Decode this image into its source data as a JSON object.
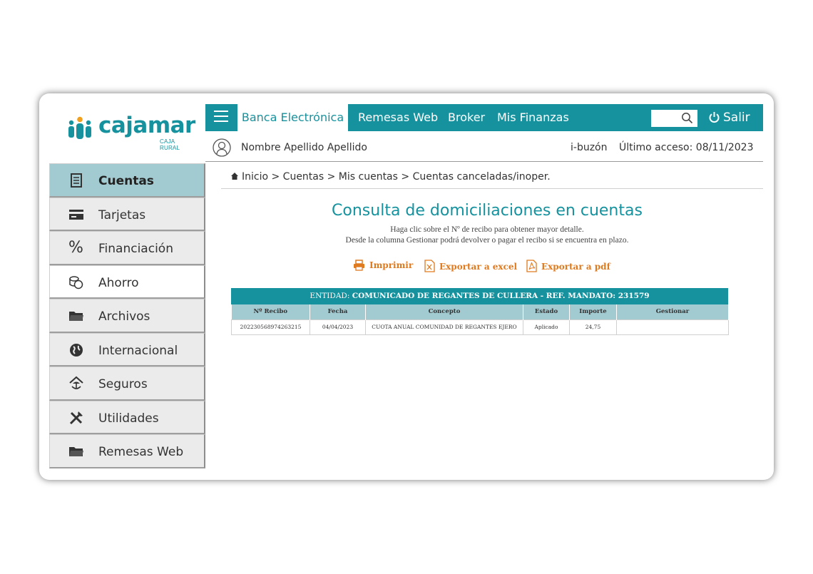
{
  "brand": {
    "name": "cajamar",
    "sub": "CAJA RURAL",
    "color": "#15929e"
  },
  "topnav": {
    "active_tab": "Banca Electrónica",
    "links": [
      "Remesas Web",
      "Broker",
      "Mis Finanzas"
    ],
    "search_placeholder": "",
    "logout_label": "Salir"
  },
  "userbar": {
    "user_name": "Nombre Apellido Apellido",
    "ibuzon": "i-buzón",
    "last_access": "Último acceso: 08/11/2023"
  },
  "sidebar": {
    "items": [
      {
        "label": "Cuentas",
        "icon": "ledger-icon",
        "active": true
      },
      {
        "label": "Tarjetas",
        "icon": "card-icon"
      },
      {
        "label": "Financiación",
        "icon": "percent-icon"
      },
      {
        "label": "Ahorro",
        "icon": "coins-icon"
      },
      {
        "label": "Archivos",
        "icon": "folder-icon"
      },
      {
        "label": "Internacional",
        "icon": "globe-icon"
      },
      {
        "label": "Seguros",
        "icon": "umbrella-house-icon"
      },
      {
        "label": "Utilidades",
        "icon": "tools-icon"
      },
      {
        "label": "Remesas Web",
        "icon": "folder-icon"
      }
    ]
  },
  "breadcrumb": "Inicio > Cuentas > Mis cuentas > Cuentas canceladas/inoper.",
  "page": {
    "title": "Consulta de domiciliaciones en cuentas",
    "help_1": "Haga clic sobre el Nº de recibo para obtener mayor detalle.",
    "help_2": "Desde la columna Gestionar podrá devolver o pagar el recibo si se encuentra en plazo."
  },
  "actions": {
    "print": "Imprimir",
    "excel": "Exportar a excel",
    "pdf": "Exportar a pdf"
  },
  "table": {
    "entity_prefix": "ENTIDAD:",
    "entity": "COMUNICADO DE REGANTES DE CULLERA - REF. MANDATO: 231579",
    "columns": [
      "Nº Recibo",
      "Fecha",
      "Concepto",
      "Estado",
      "Importe",
      "Gestionar"
    ],
    "rows": [
      {
        "recibo": "202230568974263215",
        "fecha": "04/04/2023",
        "concepto": "CUOTA ANUAL COMUNIDAD DE REGANTES EJERO",
        "estado": "Aplicado",
        "importe": "24,75",
        "gestionar": ""
      }
    ]
  }
}
